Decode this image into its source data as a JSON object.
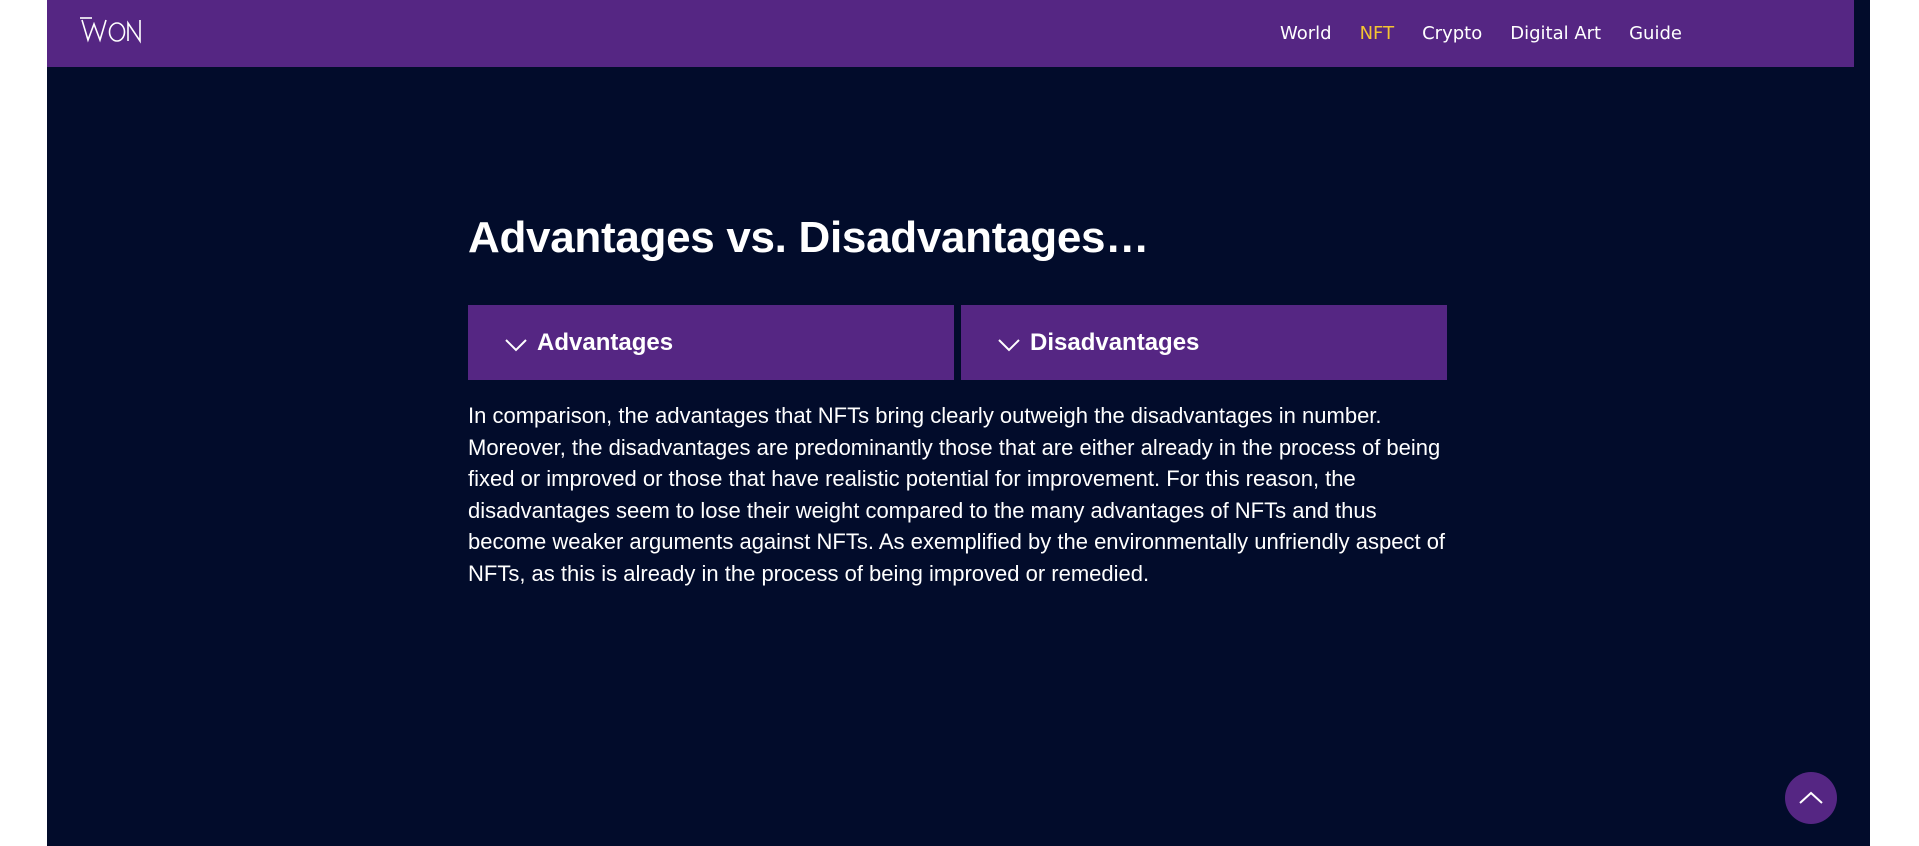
{
  "header": {
    "logo_text": "WON",
    "nav": [
      {
        "label": "World",
        "active": false
      },
      {
        "label": "NFT",
        "active": true
      },
      {
        "label": "Crypto",
        "active": false
      },
      {
        "label": "Digital Art",
        "active": false
      },
      {
        "label": "Guide",
        "active": false
      }
    ],
    "active_color": "#f4c431"
  },
  "main": {
    "heading": "Advantages vs. Disadvantages…",
    "tabs": [
      {
        "label": "Advantages",
        "icon": "chevron-down-icon"
      },
      {
        "label": "Disadvantages",
        "icon": "chevron-down-icon"
      }
    ],
    "paragraph": "In comparison, the advantages that NFTs bring clearly outweigh the disadvantages in number. Moreover, the disadvantages are predominantly those that are either already in the process of being fixed or improved or those that have realistic potential for improvement. For this reason, the disadvantages seem to lose their weight compared to the many advantages of NFTs and thus become weaker arguments against NFTs. As exemplified by the environmentally unfriendly aspect of NFTs, as this is already in the process of being improved or remedied."
  },
  "scroll_top": {
    "icon": "chevron-up-icon"
  },
  "colors": {
    "background": "#020c2b",
    "brand_purple": "#552683",
    "text": "#ffffff"
  }
}
